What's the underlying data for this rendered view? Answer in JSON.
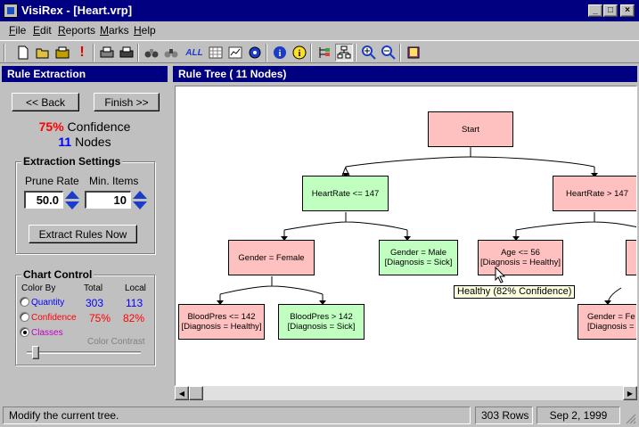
{
  "window": {
    "title": "VisiRex - [Heart.vrp]",
    "controls": {
      "minimize": "_",
      "maximize": "□",
      "close": "×"
    }
  },
  "menu": [
    "File",
    "Edit",
    "Reports",
    "Marks",
    "Help"
  ],
  "toolbar": {
    "icons": [
      "new-file-icon",
      "open-folder-icon",
      "open-file-icon",
      "alert-icon",
      "print-icon",
      "print-preview-icon",
      "find-icon",
      "find-next-icon",
      "all-icon",
      "grid-icon",
      "chart-icon",
      "settings-icon",
      "info-icon",
      "info-yellow-icon",
      "tree-icon",
      "tree-layout-icon",
      "zoom-in-icon",
      "zoom-out-icon",
      "book-icon"
    ],
    "all_label": "ALL"
  },
  "left_panel": {
    "header": "Rule Extraction",
    "back_button": "<< Back",
    "finish_button": "Finish >>",
    "confidence_value": "75%",
    "confidence_label": "Confidence",
    "nodes_value": "11",
    "nodes_label": "Nodes",
    "extraction": {
      "title": "Extraction Settings",
      "prune_rate_label": "Prune Rate",
      "prune_rate_value": "50.0",
      "min_items_label": "Min. Items",
      "min_items_value": "10",
      "extract_button": "Extract Rules Now"
    },
    "chart_control": {
      "title": "Chart Control",
      "color_by_label": "Color By",
      "total_label": "Total",
      "local_label": "Local",
      "options": [
        {
          "label": "Quantity",
          "total": "303",
          "local": "113",
          "color": "#0000ff",
          "selected": false
        },
        {
          "label": "Confidence",
          "total": "75%",
          "local": "82%",
          "color": "#ff0000",
          "selected": false
        },
        {
          "label": "Classes",
          "total": "",
          "local": "",
          "color": "#c000c0",
          "selected": true
        }
      ],
      "contrast_label": "Color Contrast",
      "contrast_level": 0.05
    }
  },
  "right_panel": {
    "header": "Rule Tree  ( 11 Nodes)",
    "nodes": [
      {
        "id": "start",
        "line1": "Start",
        "line2": "",
        "color": "red"
      },
      {
        "id": "hr-le",
        "line1": "HeartRate <= 147",
        "line2": "",
        "color": "green"
      },
      {
        "id": "hr-gt",
        "line1": "HeartRate > 147",
        "line2": "",
        "color": "red"
      },
      {
        "id": "g-female",
        "line1": "Gender = Female",
        "line2": "",
        "color": "red"
      },
      {
        "id": "g-male",
        "line1": "Gender = Male",
        "line2": "[Diagnosis = Sick]",
        "color": "green"
      },
      {
        "id": "age",
        "line1": "Age <= 56",
        "line2": "[Diagnosis = Healthy]",
        "color": "red"
      },
      {
        "id": "bp-le",
        "line1": "BloodPres <= 142",
        "line2": "[Diagnosis = Healthy]",
        "color": "red"
      },
      {
        "id": "bp-gt",
        "line1": "BloodPres > 142",
        "line2": "[Diagnosis = Sick]",
        "color": "green"
      },
      {
        "id": "g-fe2",
        "line1": "Gender = Fe",
        "line2": "[Diagnosis =",
        "color": "red"
      }
    ],
    "tooltip": "Healthy  (82% Confidence)"
  },
  "status": {
    "message": "Modify the current tree.",
    "rows": "303 Rows",
    "date": "Sep 2, 1999"
  },
  "colors": {
    "title_bar": "#000080",
    "node_red": "#ffc0c0",
    "node_green": "#c0ffc0",
    "accent_blue": "#1a3cc8"
  }
}
